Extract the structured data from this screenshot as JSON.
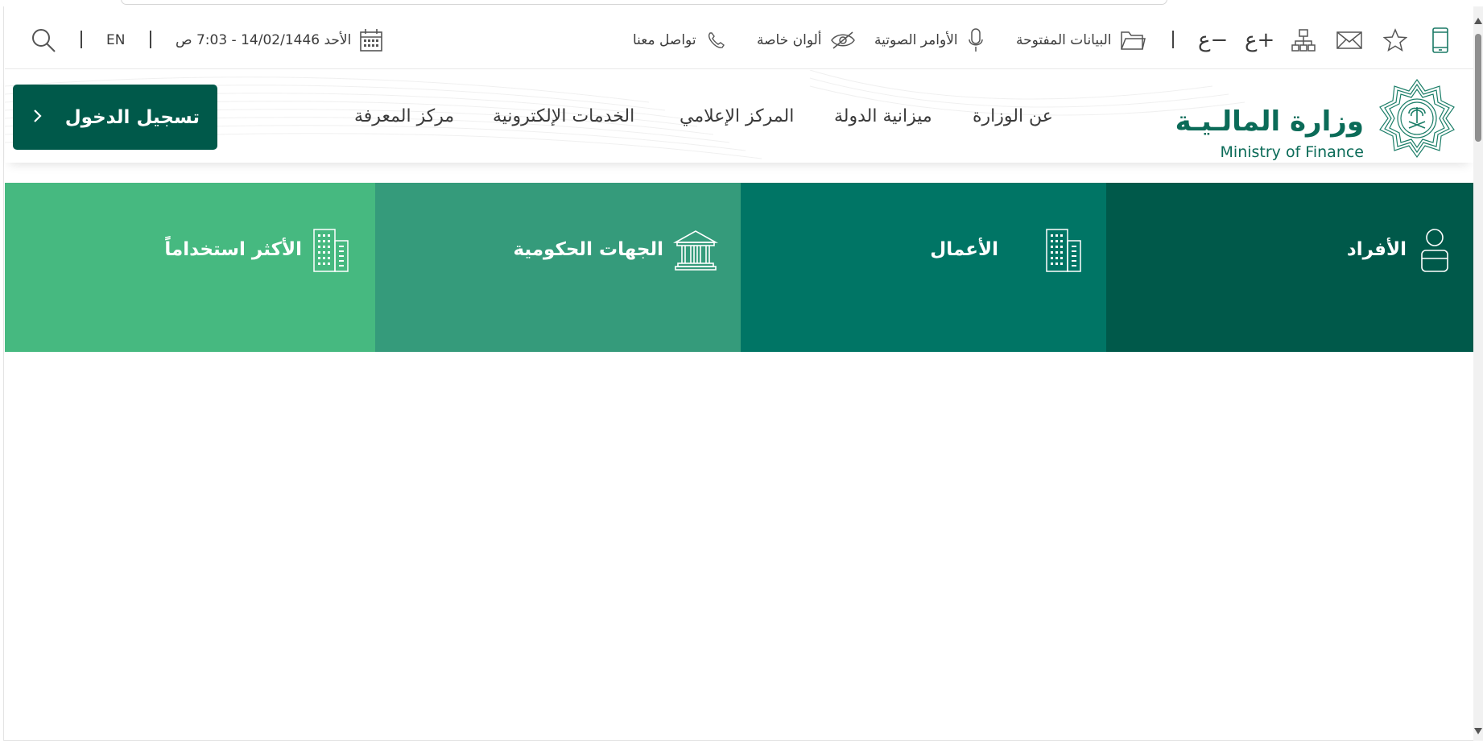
{
  "topbar": {
    "search_icon": "search-icon",
    "language": "EN",
    "datetime": "الأحد 14/02/1446 - 7:03 ص",
    "contact": "تواصل معنا",
    "special_colors": "ألوان خاصة",
    "voice_commands": "الأوامر الصوتية",
    "open_data": "البيانات المفتوحة",
    "decrease_font": "ع−",
    "increase_font": "ع+"
  },
  "header": {
    "logo_ar": "وزارة المالـيـة",
    "logo_en": "Ministry of Finance",
    "nav": [
      "عن الوزارة",
      "ميزانية الدولة",
      "المركز الإعلامي",
      "الخدمات الإلكترونية",
      "مركز المعرفة"
    ],
    "login": "تسجيل الدخول"
  },
  "tiles": [
    {
      "label": "الأفراد",
      "color": "#00594a",
      "icon": "person-icon"
    },
    {
      "label": "الأعمال",
      "color": "#007565",
      "icon": "building-icon"
    },
    {
      "label": "الجهات الحكومية",
      "color": "#359b7b",
      "icon": "government-building-icon"
    },
    {
      "label": "الأكثر استخداماً",
      "color": "#46b980",
      "icon": "building-icon"
    }
  ],
  "colors": {
    "brand": "#00594a",
    "logo_text": "#0b6b58"
  }
}
